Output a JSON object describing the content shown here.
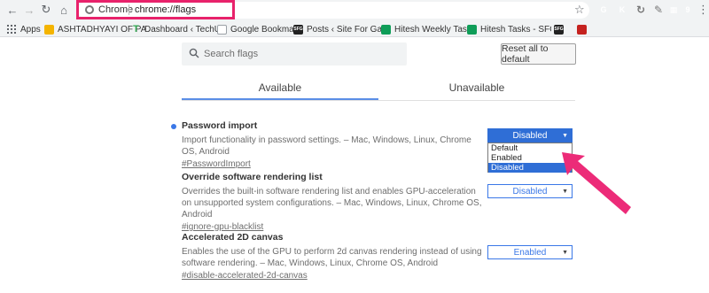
{
  "browser": {
    "site_name": "Chrome",
    "url": "chrome://flags",
    "extensions": [
      {
        "name": "G",
        "color": "#34a853"
      },
      {
        "name": "K",
        "color": "#444444"
      },
      {
        "name": "↻",
        "color": "#7a7a7a"
      },
      {
        "name": "✎",
        "color": "#7a7a7a"
      },
      {
        "name": "▦",
        "color": "#c5221f"
      },
      {
        "name": "9",
        "color": "#1a1a1a"
      },
      {
        "name": "R",
        "color": "#1a1a1a"
      }
    ]
  },
  "bookmarks": [
    {
      "label": "Apps",
      "icon": "apps-icon",
      "color": "#5f6368"
    },
    {
      "label": "ASHTADHYAYI OF PA",
      "icon": "folder-icon",
      "color": "#f4b400"
    },
    {
      "label": "Dashboard ‹ TechUnt",
      "icon": "t-icon",
      "color": "#34a853"
    },
    {
      "label": "Google Bookmark",
      "icon": "doc-icon",
      "color": "#9aa0a6"
    },
    {
      "label": "Posts ‹ Site For Game",
      "icon": "sfg-icon",
      "color": "#222222"
    },
    {
      "label": "Hitesh Weekly Tasks",
      "icon": "sheet-icon",
      "color": "#0f9d58"
    },
    {
      "label": "Hitesh Tasks - SFG -",
      "icon": "sheet-icon",
      "color": "#0f9d58"
    },
    {
      "label": "",
      "icon": "sfg-icon",
      "color": "#222222"
    },
    {
      "label": "",
      "icon": "qr-icon",
      "color": "#c5221f"
    }
  ],
  "sfg_label": "SFG",
  "search": {
    "placeholder": "Search flags"
  },
  "reset_button": "Reset all to default",
  "tabs": {
    "available": "Available",
    "unavailable": "Unavailable"
  },
  "flags": [
    {
      "title": "Password import",
      "description": "Import functionality in password settings. – Mac, Windows, Linux, Chrome OS, Android",
      "link": "#PasswordImport",
      "value": "Disabled",
      "options": [
        "Default",
        "Enabled",
        "Disabled"
      ]
    },
    {
      "title": "Override software rendering list",
      "description": "Overrides the built-in software rendering list and enables GPU-acceleration on unsupported system configurations. – Mac, Windows, Linux, Chrome OS, Android",
      "link": "#ignore-gpu-blacklist",
      "value": "Disabled"
    },
    {
      "title": "Accelerated 2D canvas",
      "description": "Enables the use of the GPU to perform 2d canvas rendering instead of using software rendering. – Mac, Windows, Linux, Chrome OS, Android",
      "link": "#disable-accelerated-2d-canvas",
      "value": "Enabled"
    }
  ],
  "accent_colors": {
    "highlight": "#e8226b",
    "blue": "#3b78e7"
  }
}
